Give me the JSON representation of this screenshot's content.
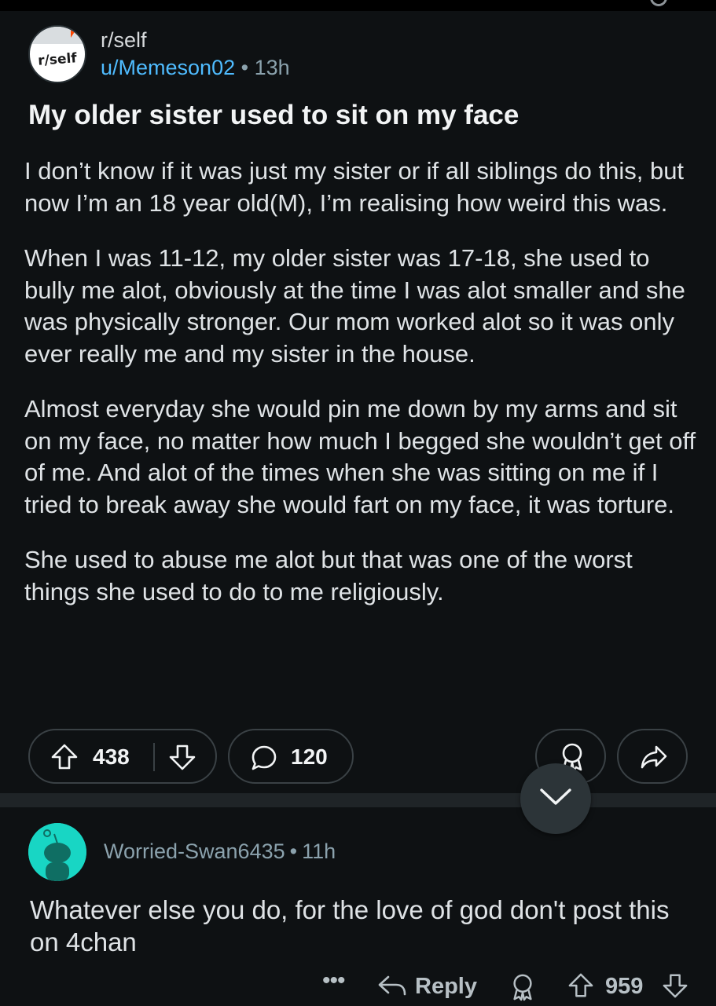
{
  "post": {
    "subreddit": "r/self",
    "subreddit_icon_text": "r/self",
    "author": "u/Memeson02",
    "separator": "•",
    "time": "13h",
    "title": "My older sister used to sit on my face",
    "paragraphs": [
      "I don’t know if it was just my sister or if all siblings do this, but now I’m an 18 year old(M), I’m realising how weird this was.",
      "When I was 11-12, my older sister was 17-18, she used to bully me alot, obviously at the time I was alot smaller and she was physically stronger. Our mom worked alot so it was only ever really me and my sister in the house.",
      "Almost everyday she would pin me down by my arms and sit on my face, no matter how much I begged she wouldn’t get off of me. And alot of the times when she was sitting on me if I tried to break away she would fart on my face, it was torture.",
      "She used to abuse me alot but that was one of the worst things she used to do to me religiously."
    ],
    "score": "438",
    "comment_count": "120"
  },
  "icons": {
    "upvote": "upvote-arrow-icon",
    "downvote": "downvote-arrow-icon",
    "comment": "speech-bubble-icon",
    "award": "award-ribbon-icon",
    "share": "share-arrow-icon",
    "jump": "chevron-down-icon",
    "reply": "reply-arrow-icon",
    "more": "ellipsis-icon"
  },
  "comment": {
    "author": "Worried-Swan6435",
    "separator": "•",
    "time": "11h",
    "body": "Whatever else you do, for the love of god don't post this on 4chan",
    "more_label": "•••",
    "reply_label": "Reply",
    "score": "959"
  },
  "colors": {
    "background": "#0e1113",
    "username": "#4fbcff",
    "meta": "#8ba2ad",
    "avatar_teal": "#18d6c4"
  }
}
